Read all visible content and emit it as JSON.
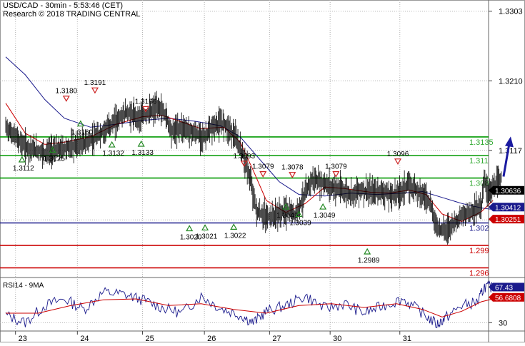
{
  "header": {
    "line1": "USD/CAD - 30min - 5:53:46 (CET)",
    "line2": "Research © 2018 TRADING CENTRAL"
  },
  "colors": {
    "price": "#000000",
    "ma_fast": "#cc0000",
    "ma_slow": "#1a1a8c",
    "support": "#1a1a8c",
    "resistance_green": "#009900",
    "red_level": "#cc0000",
    "arrow": "#1a1aa0",
    "rsi": "#1a1a8c",
    "rsi_ma": "#cc0000",
    "grid": "#b4b4b4",
    "label_green": "#33aa33",
    "label_blue": "#1a1a8c",
    "label_red": "#cc0000"
  },
  "chart_data": [
    {
      "type": "line",
      "x": [
        "23",
        "24",
        "25",
        "26",
        "27",
        "30",
        "31"
      ],
      "ylim": [
        1.2948,
        1.3318
      ],
      "y_ticks": [
        "1.3303",
        "1.3210",
        "1.3117",
        "1.3024"
      ],
      "series": [
        {
          "name": "price",
          "values": [
            [
              22.0,
              1.3148
            ],
            [
              22.3,
              1.3122
            ],
            [
              22.6,
              1.3114
            ],
            [
              22.9,
              1.312
            ],
            [
              23.15,
              1.3125
            ],
            [
              23.35,
              1.3132
            ],
            [
              23.6,
              1.315
            ],
            [
              23.85,
              1.3168
            ],
            [
              24.05,
              1.316
            ],
            [
              24.25,
              1.317
            ],
            [
              24.35,
              1.3175
            ],
            [
              24.45,
              1.3165
            ],
            [
              24.55,
              1.3142
            ],
            [
              24.7,
              1.3148
            ],
            [
              24.9,
              1.314
            ],
            [
              25.05,
              1.3135
            ],
            [
              25.2,
              1.315
            ],
            [
              25.35,
              1.3154
            ],
            [
              25.5,
              1.3138
            ],
            [
              25.65,
              1.311
            ],
            [
              25.75,
              1.308
            ],
            [
              25.85,
              1.3035
            ],
            [
              26.0,
              1.3028
            ],
            [
              26.15,
              1.303
            ],
            [
              26.3,
              1.3036
            ],
            [
              26.45,
              1.3032
            ],
            [
              26.6,
              1.306
            ],
            [
              26.7,
              1.3078
            ],
            [
              26.85,
              1.3074
            ],
            [
              27.0,
              1.3068
            ],
            [
              27.15,
              1.3064
            ],
            [
              27.3,
              1.3058
            ],
            [
              27.45,
              1.3065
            ],
            [
              27.6,
              1.306
            ],
            [
              27.75,
              1.3063
            ],
            [
              27.9,
              1.3057
            ],
            [
              28.05,
              1.306
            ],
            [
              28.15,
              1.307
            ],
            [
              28.3,
              1.3066
            ],
            [
              28.5,
              1.305
            ],
            [
              28.62,
              1.3014
            ],
            [
              28.75,
              1.301
            ],
            [
              28.9,
              1.3022
            ],
            [
              29.05,
              1.3032
            ],
            [
              29.2,
              1.3038
            ],
            [
              29.3,
              1.3042
            ],
            [
              29.35,
              1.308
            ],
            [
              29.4,
              1.306
            ],
            [
              29.5,
              1.3068
            ],
            [
              29.62,
              1.308
            ]
          ]
        },
        {
          "name": "moving average (fast)",
          "values": [
            [
              22.0,
              1.318
            ],
            [
              22.3,
              1.314
            ],
            [
              22.6,
              1.3125
            ],
            [
              22.9,
              1.3128
            ],
            [
              23.3,
              1.3135
            ],
            [
              23.7,
              1.3152
            ],
            [
              24.1,
              1.3162
            ],
            [
              24.4,
              1.3164
            ],
            [
              24.7,
              1.3155
            ],
            [
              25.0,
              1.3146
            ],
            [
              25.35,
              1.3148
            ],
            [
              25.6,
              1.3128
            ],
            [
              25.8,
              1.309
            ],
            [
              26.0,
              1.305
            ],
            [
              26.3,
              1.3034
            ],
            [
              26.6,
              1.3046
            ],
            [
              26.9,
              1.3068
            ],
            [
              27.2,
              1.3066
            ],
            [
              27.6,
              1.3061
            ],
            [
              27.9,
              1.306
            ],
            [
              28.2,
              1.3064
            ],
            [
              28.45,
              1.3058
            ],
            [
              28.7,
              1.3032
            ],
            [
              29.0,
              1.3022
            ],
            [
              29.3,
              1.3035
            ],
            [
              29.48,
              1.305
            ]
          ]
        },
        {
          "name": "moving average (slow)",
          "values": [
            [
              22.0,
              1.3242
            ],
            [
              22.3,
              1.3218
            ],
            [
              22.6,
              1.3185
            ],
            [
              22.9,
              1.316
            ],
            [
              23.3,
              1.3148
            ],
            [
              23.7,
              1.3152
            ],
            [
              24.1,
              1.3157
            ],
            [
              24.5,
              1.316
            ],
            [
              24.9,
              1.3156
            ],
            [
              25.3,
              1.315
            ],
            [
              25.6,
              1.3135
            ],
            [
              25.9,
              1.3105
            ],
            [
              26.2,
              1.3075
            ],
            [
              26.5,
              1.3058
            ],
            [
              26.9,
              1.3056
            ],
            [
              27.3,
              1.306
            ],
            [
              27.7,
              1.3058
            ],
            [
              28.1,
              1.306
            ],
            [
              28.4,
              1.3062
            ],
            [
              28.7,
              1.3054
            ],
            [
              29.0,
              1.3046
            ],
            [
              29.3,
              1.304
            ],
            [
              29.48,
              1.3038
            ]
          ]
        }
      ],
      "levels": [
        {
          "name": "resistance-1.3135",
          "value": 1.3135,
          "color": "#009900",
          "label": "1.3135"
        },
        {
          "name": "resistance-1.311",
          "value": 1.311,
          "color": "#009900",
          "label": "1.311"
        },
        {
          "name": "resistance-1.308",
          "value": 1.308,
          "color": "#009900",
          "label": "1.308"
        },
        {
          "name": "support-1.302",
          "value": 1.302,
          "color": "#1a1a8c",
          "label": "1.302"
        },
        {
          "name": "support-1.299",
          "value": 1.299,
          "color": "#cc0000",
          "label": "1.299"
        },
        {
          "name": "support-1.296",
          "value": 1.296,
          "color": "#cc0000",
          "label": "1.296"
        }
      ],
      "tags": [
        {
          "label": "1.30636",
          "value": 1.30636,
          "bg": "#000000",
          "fg": "#ffffff"
        },
        {
          "label": "1.30412",
          "value": 1.30412,
          "bg": "#1a1a8c",
          "fg": "#ffffff"
        },
        {
          "label": "1.30251",
          "value": 1.30251,
          "bg": "#cc0000",
          "fg": "#ffffff"
        }
      ],
      "annotations": [
        {
          "text": "1.3112",
          "x": 22.25,
          "y": 1.3112,
          "kind": "low"
        },
        {
          "text": "1.3125",
          "x": 22.72,
          "y": 1.3125,
          "kind": "low"
        },
        {
          "text": "1.3180",
          "x": 22.93,
          "y": 1.318,
          "kind": "high"
        },
        {
          "text": "1.3160",
          "x": 23.15,
          "y": 1.316,
          "kind": "low"
        },
        {
          "text": "1.3191",
          "x": 23.37,
          "y": 1.3191,
          "kind": "high"
        },
        {
          "text": "1.3132",
          "x": 23.63,
          "y": 1.3132,
          "kind": "low"
        },
        {
          "text": "1.3133",
          "x": 24.08,
          "y": 1.3133,
          "kind": "low"
        },
        {
          "text": "1.3166",
          "x": 24.15,
          "y": 1.3166,
          "kind": "high"
        },
        {
          "text": "1.3020",
          "x": 24.82,
          "y": 1.302,
          "kind": "low"
        },
        {
          "text": "1.3021",
          "x": 25.06,
          "y": 1.3021,
          "kind": "low"
        },
        {
          "text": "1.3022",
          "x": 25.5,
          "y": 1.3022,
          "kind": "low"
        },
        {
          "text": "1.3093",
          "x": 25.66,
          "y": 1.3093,
          "kind": "high"
        },
        {
          "text": "1.3079",
          "x": 25.95,
          "y": 1.3079,
          "kind": "high"
        },
        {
          "text": "1.3078",
          "x": 26.4,
          "y": 1.3078,
          "kind": "high"
        },
        {
          "text": "1.3049",
          "x": 26.3,
          "y": 1.3049,
          "kind": "low"
        },
        {
          "text": "1.3039",
          "x": 26.5,
          "y": 1.3039,
          "kind": "low"
        },
        {
          "text": "1.3049",
          "x": 26.87,
          "y": 1.3049,
          "kind": "low"
        },
        {
          "text": "1.3079",
          "x": 27.07,
          "y": 1.3079,
          "kind": "high"
        },
        {
          "text": "1.2989",
          "x": 27.55,
          "y": 1.2989,
          "kind": "low"
        },
        {
          "text": "1.3096",
          "x": 28.02,
          "y": 1.3096,
          "kind": "high"
        }
      ]
    },
    {
      "type": "line",
      "title": "RSI14 - 9MA",
      "ylim": [
        22,
        76
      ],
      "y_ticks": [
        "30"
      ],
      "series": [
        {
          "name": "RSI",
          "values": [
            [
              22.0,
              38
            ],
            [
              22.3,
              30
            ],
            [
              22.6,
              48
            ],
            [
              22.9,
              55
            ],
            [
              23.2,
              44
            ],
            [
              23.5,
              62
            ],
            [
              23.8,
              60
            ],
            [
              24.1,
              54
            ],
            [
              24.4,
              46
            ],
            [
              24.7,
              40
            ],
            [
              25.0,
              58
            ],
            [
              25.3,
              45
            ],
            [
              25.6,
              38
            ],
            [
              25.8,
              30
            ],
            [
              26.0,
              42
            ],
            [
              26.3,
              48
            ],
            [
              26.6,
              58
            ],
            [
              26.9,
              45
            ],
            [
              27.2,
              50
            ],
            [
              27.5,
              40
            ],
            [
              27.8,
              48
            ],
            [
              28.1,
              55
            ],
            [
              28.4,
              40
            ],
            [
              28.62,
              28
            ],
            [
              28.75,
              35
            ],
            [
              29.0,
              48
            ],
            [
              29.25,
              52
            ],
            [
              29.35,
              68
            ],
            [
              29.48,
              67
            ]
          ]
        },
        {
          "name": "RSI MA",
          "values": [
            [
              22.0,
              40
            ],
            [
              22.5,
              40
            ],
            [
              23.0,
              48
            ],
            [
              23.5,
              54
            ],
            [
              24.0,
              55
            ],
            [
              24.5,
              48
            ],
            [
              25.0,
              50
            ],
            [
              25.5,
              44
            ],
            [
              26.0,
              40
            ],
            [
              26.5,
              48
            ],
            [
              27.0,
              50
            ],
            [
              27.5,
              46
            ],
            [
              28.0,
              50
            ],
            [
              28.4,
              44
            ],
            [
              28.7,
              36
            ],
            [
              29.0,
              42
            ],
            [
              29.3,
              52
            ],
            [
              29.48,
              55
            ]
          ]
        }
      ],
      "tags": [
        {
          "label": "67.43",
          "value": 67.43,
          "bg": "#1a1a8c",
          "fg": "#ffffff"
        },
        {
          "label": "56.6808",
          "value": 56.6808,
          "bg": "#cc0000",
          "fg": "#ffffff"
        }
      ]
    }
  ]
}
